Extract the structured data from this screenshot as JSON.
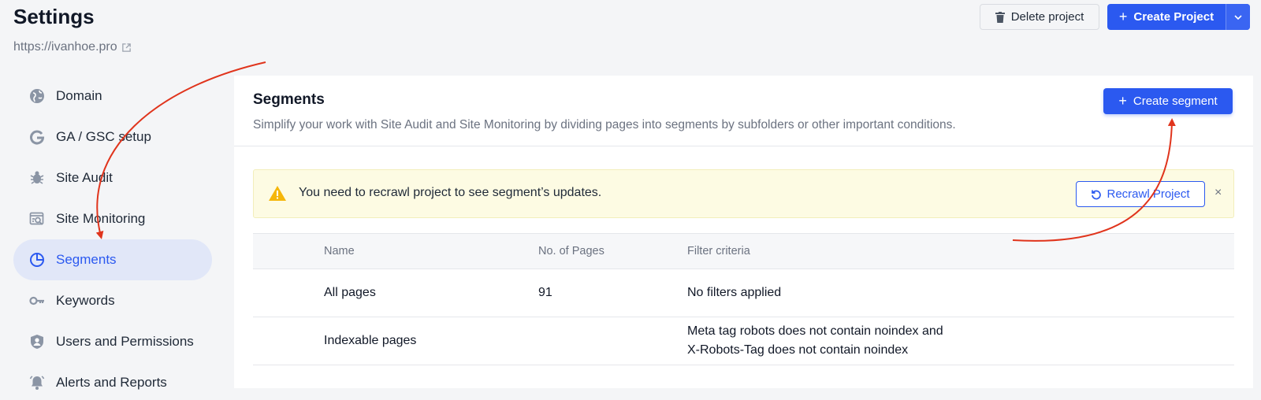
{
  "header": {
    "title": "Settings",
    "site_url": "https://ivanhoe.pro",
    "delete_label": "Delete project",
    "create_label": "Create Project"
  },
  "sidebar": {
    "items": [
      {
        "label": "Domain",
        "icon": "globe-icon",
        "active": false
      },
      {
        "label": "GA / GSC setup",
        "icon": "google-icon",
        "active": false
      },
      {
        "label": "Site Audit",
        "icon": "bug-icon",
        "active": false
      },
      {
        "label": "Site Monitoring",
        "icon": "monitoring-icon",
        "active": false
      },
      {
        "label": "Segments",
        "icon": "pie-icon",
        "active": true
      },
      {
        "label": "Keywords",
        "icon": "key-icon",
        "active": false
      },
      {
        "label": "Users and Permissions",
        "icon": "shield-user-icon",
        "active": false
      },
      {
        "label": "Alerts and Reports",
        "icon": "bell-icon",
        "active": false
      }
    ]
  },
  "panel": {
    "title": "Segments",
    "description": "Simplify your work with Site Audit and Site Monitoring by dividing pages into segments by subfolders or other important conditions.",
    "create_segment_label": "Create segment"
  },
  "alert": {
    "message": "You need to recrawl project to see segment’s updates.",
    "recrawl_label": "Recrawl Project",
    "close_glyph": "×"
  },
  "table": {
    "headers": [
      "Name",
      "No. of Pages",
      "Filter criteria"
    ],
    "rows": [
      {
        "name": "All pages",
        "pages": "91",
        "criteria_1": "No filters applied",
        "criteria_2": ""
      },
      {
        "name": "Indexable pages",
        "pages": "",
        "criteria_1": "Meta tag robots does not contain noindex and",
        "criteria_2": "X-Robots-Tag does not contain noindex"
      }
    ]
  },
  "colors": {
    "accent": "#2b59f0",
    "annotation_arrow": "#e0341c",
    "alert_bg": "#fdfbe3",
    "active_bg": "#e1e7f8"
  }
}
